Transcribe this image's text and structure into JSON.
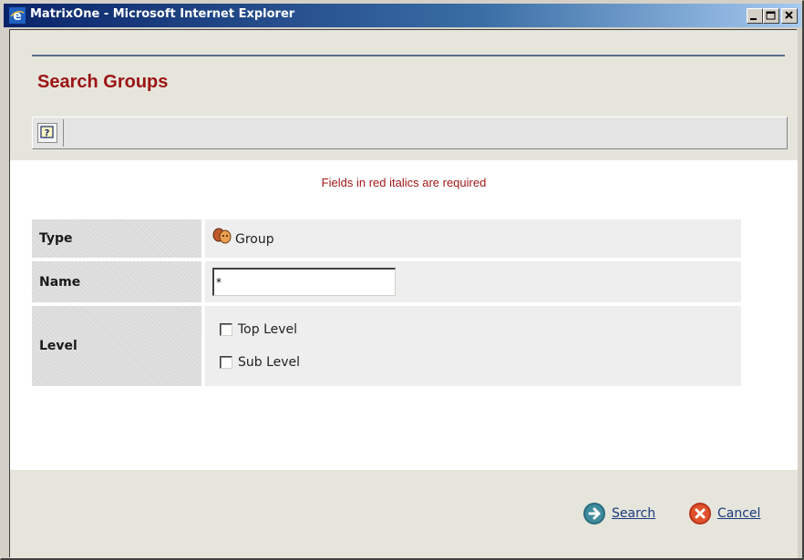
{
  "window": {
    "title": "MatrixOne - Microsoft Internet Explorer",
    "browser_icon": "ie-icon",
    "controls": [
      "minimize-icon",
      "maximize-icon",
      "close-icon"
    ]
  },
  "header": {
    "title": "Search Groups",
    "title_color": "#9c1414"
  },
  "toolbar": {
    "help_icon": "help-icon"
  },
  "form": {
    "required_note": "Fields in red italics are required",
    "required_color": "#a01818",
    "type": {
      "label": "Type",
      "value": "Group",
      "icon": "group-icon"
    },
    "name": {
      "label": "Name",
      "value": "*"
    },
    "level": {
      "label": "Level",
      "options": [
        {
          "label": "Top Level",
          "checked": false
        },
        {
          "label": "Sub Level",
          "checked": false
        }
      ]
    }
  },
  "footer": {
    "search_label": "Search",
    "search_icon": "arrow-right-icon",
    "cancel_label": "Cancel",
    "cancel_icon": "cancel-x-icon",
    "link_color": "#1a3a7c"
  }
}
